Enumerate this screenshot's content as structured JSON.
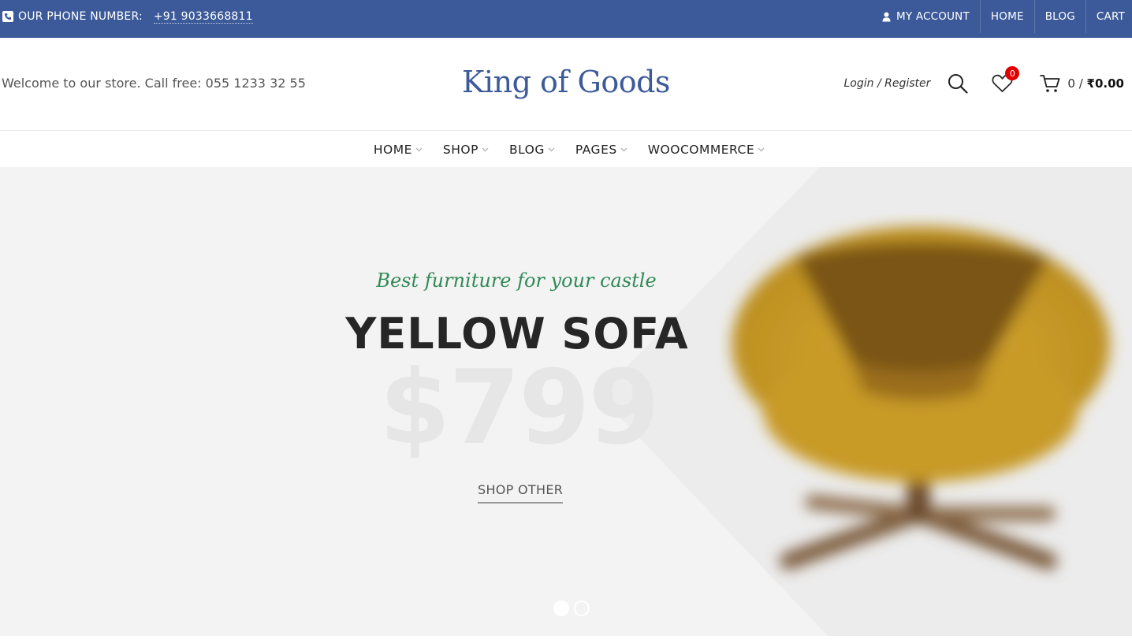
{
  "topbar": {
    "phone_label": "OUR PHONE NUMBER:",
    "phone_number": "+91 9033668811",
    "links": [
      {
        "label": "MY ACCOUNT",
        "icon": "user-icon"
      },
      {
        "label": "HOME"
      },
      {
        "label": "BLOG"
      },
      {
        "label": "CART"
      }
    ]
  },
  "header": {
    "welcome": "Welcome to our store. Call free: 055 1233 32 55",
    "logo": "King of Goods",
    "login": "Login / Register",
    "wishlist_count": "0",
    "cart_count": "0 /",
    "cart_total": "₹0.00"
  },
  "nav": {
    "items": [
      "HOME",
      "SHOP",
      "BLOG",
      "PAGES",
      "WOOCOMMERCE"
    ]
  },
  "hero": {
    "tagline": "Best furniture for your castle",
    "title": "YELLOW SOFA",
    "price": "$799",
    "button": "SHOP OTHER",
    "slides": 2,
    "active_slide": 1
  },
  "colors": {
    "topbar_bg": "#3c5a99",
    "logo": "#3c5a99",
    "tagline": "#2f8a55",
    "badge": "#e00000",
    "hero_bg": "#f3f3f3"
  }
}
